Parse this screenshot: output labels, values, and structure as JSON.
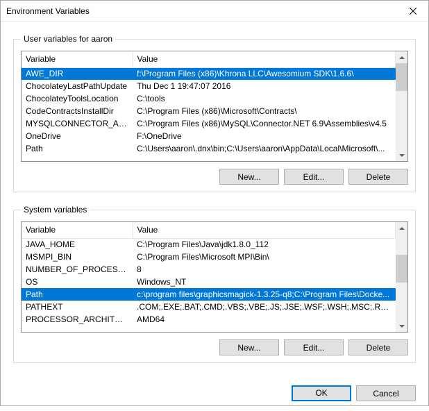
{
  "title": "Environment Variables",
  "userSection": {
    "legend": "User variables for aaron",
    "columns": {
      "var": "Variable",
      "val": "Value"
    },
    "rows": [
      {
        "var": "AWE_DIR",
        "val": "f:\\Program Files (x86)\\Khrona LLC\\Awesomium SDK\\1.6.6\\",
        "sel": true
      },
      {
        "var": "ChocolateyLastPathUpdate",
        "val": "Thu Dec  1 19:47:07 2016"
      },
      {
        "var": "ChocolateyToolsLocation",
        "val": "C:\\tools"
      },
      {
        "var": "CodeContractsInstallDir",
        "val": "C:\\Program Files (x86)\\Microsoft\\Contracts\\"
      },
      {
        "var": "MYSQLCONNECTOR_ASSE...",
        "val": "C:\\Program Files (x86)\\MySQL\\Connector.NET 6.9\\Assemblies\\v4.5"
      },
      {
        "var": "OneDrive",
        "val": "F:\\OneDrive"
      },
      {
        "var": "Path",
        "val": "C:\\Users\\aaron\\.dnx\\bin;C:\\Users\\aaron\\AppData\\Local\\Microsoft\\..."
      }
    ],
    "buttons": {
      "new": "New...",
      "edit": "Edit...",
      "del": "Delete"
    }
  },
  "sysSection": {
    "legend": "System variables",
    "columns": {
      "var": "Variable",
      "val": "Value"
    },
    "rows": [
      {
        "var": "JAVA_HOME",
        "val": "C:\\Program Files\\Java\\jdk1.8.0_112"
      },
      {
        "var": "MSMPI_BIN",
        "val": "C:\\Program Files\\Microsoft MPI\\Bin\\"
      },
      {
        "var": "NUMBER_OF_PROCESSORS",
        "val": "8"
      },
      {
        "var": "OS",
        "val": "Windows_NT"
      },
      {
        "var": "Path",
        "val": "c:\\program files\\graphicsmagick-1.3.25-q8;C:\\Program Files\\Docke...",
        "sel": true
      },
      {
        "var": "PATHEXT",
        "val": ".COM;.EXE;.BAT;.CMD;.VBS;.VBE;.JS;.JSE;.WSF;.WSH;.MSC;.RB;.RBW"
      },
      {
        "var": "PROCESSOR_ARCHITECTURE",
        "val": "AMD64"
      }
    ],
    "buttons": {
      "new": "New...",
      "edit": "Edit...",
      "del": "Delete"
    }
  },
  "dialogButtons": {
    "ok": "OK",
    "cancel": "Cancel"
  }
}
